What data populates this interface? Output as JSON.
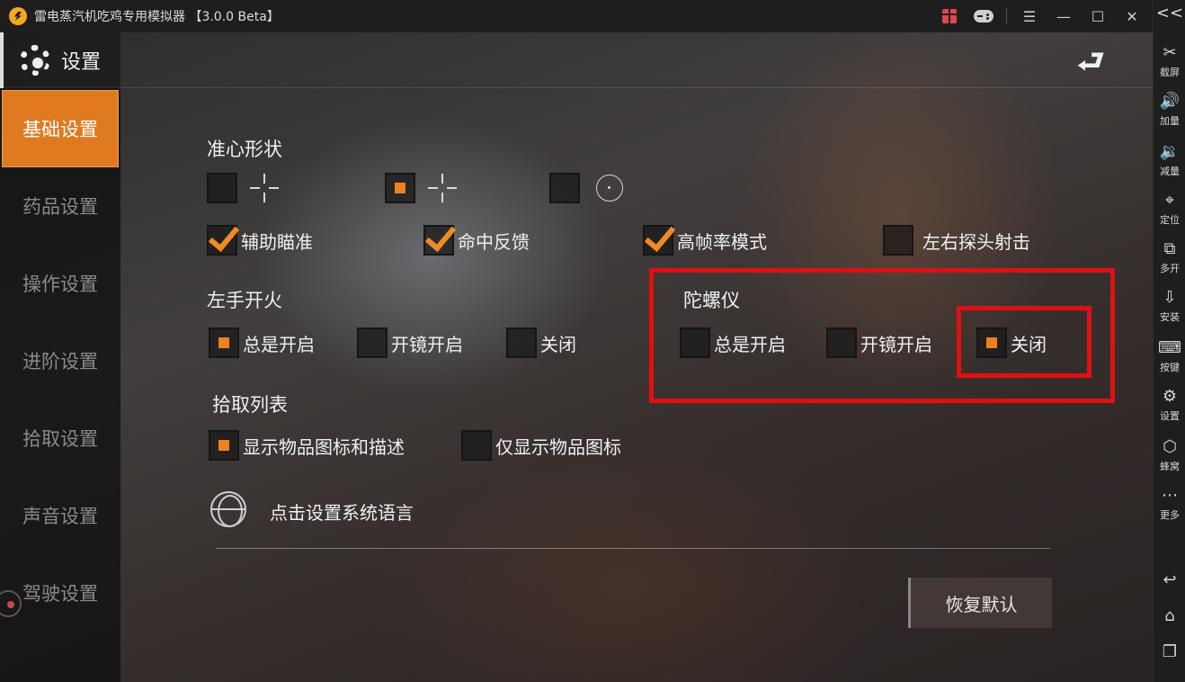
{
  "app": {
    "title": "雷电蒸汽机吃鸡专用模拟器 【3.0.0 Beta】"
  },
  "titlebar_icons": [
    "gift-icon",
    "gamepad-icon",
    "menu-icon",
    "minimize-icon",
    "maximize-icon",
    "close-icon"
  ],
  "rightbar": {
    "collapse": "<<",
    "items": [
      {
        "icon": "scissors-icon",
        "glyph": "✂",
        "label": "截屏"
      },
      {
        "icon": "volume-up-icon",
        "glyph": "🔊",
        "label": "加量"
      },
      {
        "icon": "volume-down-icon",
        "glyph": "🔉",
        "label": "减量"
      },
      {
        "icon": "location-icon",
        "glyph": "⌖",
        "label": "定位"
      },
      {
        "icon": "multi-instance-icon",
        "glyph": "⧉",
        "label": "多开"
      },
      {
        "icon": "apk-install-icon",
        "glyph": "⇩",
        "label": "安装"
      },
      {
        "icon": "keyboard-icon",
        "glyph": "⌨",
        "label": "按键"
      },
      {
        "icon": "settings-icon",
        "glyph": "⚙",
        "label": "设置"
      },
      {
        "icon": "hive-icon",
        "glyph": "⬡",
        "label": "蜂窝"
      },
      {
        "icon": "more-icon",
        "glyph": "⋯",
        "label": "更多"
      }
    ],
    "nav": [
      {
        "icon": "back-icon",
        "glyph": "↩"
      },
      {
        "icon": "home-icon",
        "glyph": "⌂"
      },
      {
        "icon": "recent-apps-icon",
        "glyph": "❐"
      }
    ]
  },
  "header": {
    "title": "设置"
  },
  "menu": {
    "items": [
      "基础设置",
      "药品设置",
      "操作设置",
      "进阶设置",
      "拾取设置",
      "声音设置",
      "驾驶设置"
    ],
    "active_index": 0
  },
  "crosshair": {
    "title": "准心形状",
    "options": [
      {
        "style": "cross",
        "selected": false
      },
      {
        "style": "cross",
        "selected": true
      },
      {
        "style": "circle",
        "selected": false
      }
    ]
  },
  "toggles": [
    {
      "label": "辅助瞄准",
      "checked": true
    },
    {
      "label": "命中反馈",
      "checked": true
    },
    {
      "label": "高帧率模式",
      "checked": true
    },
    {
      "label": "左右探头射击",
      "checked": false
    }
  ],
  "left_fire": {
    "title": "左手开火",
    "options": [
      {
        "label": "总是开启",
        "selected": true
      },
      {
        "label": "开镜开启",
        "selected": false
      },
      {
        "label": "关闭",
        "selected": false
      }
    ]
  },
  "gyroscope": {
    "title": "陀螺仪",
    "options": [
      {
        "label": "总是开启",
        "selected": false
      },
      {
        "label": "开镜开启",
        "selected": false
      },
      {
        "label": "关闭",
        "selected": true
      }
    ]
  },
  "pickup_list": {
    "title": "拾取列表",
    "options": [
      {
        "label": "显示物品图标和描述",
        "selected": true
      },
      {
        "label": "仅显示物品图标",
        "selected": false
      }
    ]
  },
  "language": {
    "label": "点击设置系统语言"
  },
  "reset_label": "恢复默认",
  "colors": {
    "accent": "#e07a21",
    "highlight": "#e01010"
  }
}
